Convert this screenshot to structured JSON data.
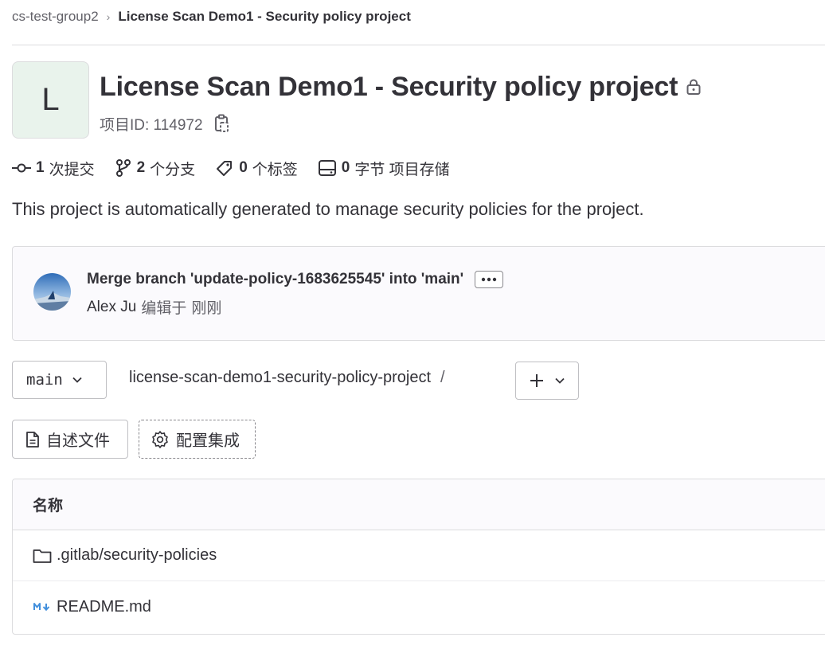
{
  "breadcrumb": {
    "group": "cs-test-group2",
    "separator": "›",
    "current": "License Scan Demo1 - Security policy project"
  },
  "project": {
    "avatar_letter": "L",
    "title": "License Scan Demo1 - Security policy project",
    "id_label": "项目ID: 114972",
    "description": "This project is automatically generated to manage security policies for the project."
  },
  "stats": {
    "commits": {
      "num": "1",
      "label": "次提交",
      "icon": "commit-icon"
    },
    "branches": {
      "num": "2",
      "label": "个分支",
      "icon": "branch-icon"
    },
    "tags": {
      "num": "0",
      "label": "个标签",
      "icon": "tag-icon"
    },
    "storage": {
      "num": "0",
      "label": "字节 项目存储",
      "icon": "storage-icon"
    }
  },
  "commit": {
    "title": "Merge branch 'update-policy-1683625545' into 'main'",
    "author": "Alex Ju",
    "edited": "编辑于",
    "time": "刚刚"
  },
  "repo": {
    "branch": "main",
    "path": "license-scan-demo1-security-policy-project",
    "path_separator": "/"
  },
  "actions": {
    "readme": "自述文件",
    "configure": "配置集成"
  },
  "files": {
    "header": "名称",
    "rows": [
      {
        "name": ".gitlab/security-policies",
        "icon": "folder-icon"
      },
      {
        "name": "README.md",
        "icon": "markdown-icon"
      }
    ]
  },
  "colors": {
    "text": "#333238",
    "muted": "#626168",
    "border": "#dcdcde",
    "avatar_bg": "#e9f3ec",
    "markdown_blue": "#428fdc"
  }
}
